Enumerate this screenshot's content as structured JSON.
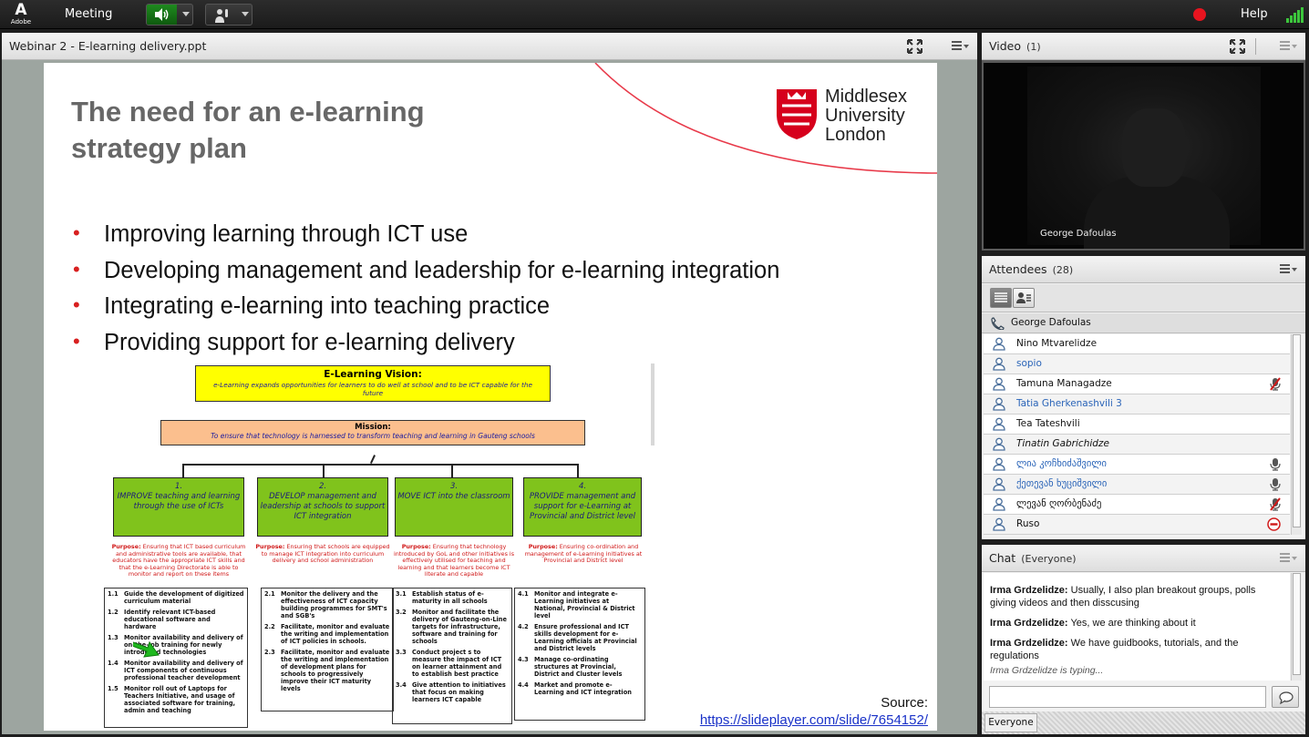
{
  "app": {
    "logo_text": "Adobe",
    "menu_meeting": "Meeting",
    "help": "Help"
  },
  "share": {
    "title": "Webinar 2 -  E-learning delivery.ppt",
    "slide": {
      "title_line1": "The need for an e-learning",
      "title_line2": "strategy plan",
      "logo": {
        "line1": "Middlesex",
        "line2": "University",
        "line3": "London"
      },
      "bullets": [
        "Improving learning through ICT use",
        "Developing management and leadership for e-learning integration",
        "Integrating e-learning into teaching practice",
        "Providing support for e-learning delivery"
      ],
      "source_label": "Source:",
      "source_url": "https://slideplayer.com/slide/7654152/",
      "diagram": {
        "vision_title": "E-Learning Vision:",
        "vision_text": "e-Learning expands opportunities for learners to do well at school and to be ICT capable for the future",
        "mission_title": "Mission:",
        "mission_text": "To ensure that technology is harnessed to transform teaching and learning in Gauteng schools",
        "goals": [
          {
            "num": "1.",
            "text": "IMPROVE teaching and learning through the use of ICTs"
          },
          {
            "num": "2.",
            "text": "DEVELOP management and leadership at schools to support ICT integration"
          },
          {
            "num": "3.",
            "text": "MOVE ICT into the classroom"
          },
          {
            "num": "4.",
            "text": "PROVIDE management and support for e-Learning at Provincial and District level"
          }
        ],
        "purpose_label": "Purpose:",
        "purposes": [
          "Ensuring that ICT based curriculum and administrative tools are available, that educators have the appropriate ICT skills and that the e-Learning Directorate is able to monitor and report on these items",
          "Ensuring that schools are equipped to manage ICT integration into curriculum delivery and school administration",
          "Ensuring that technology introduced by GoL and other initiatives is effectively utilised for teaching and learning and that learners become ICT literate and capable",
          "Ensuring co-ordination and management of e-Learning initiatives at Provincial and District level"
        ],
        "tasks": [
          [
            {
              "n": "1.1",
              "t": "Guide the development of digitized curriculum material"
            },
            {
              "n": "1.2",
              "t": "Identify relevant ICT-based educational software and hardware"
            },
            {
              "n": "1.3",
              "t": "Monitor availability and delivery of on-the-job training for newly introduced technologies"
            },
            {
              "n": "1.4",
              "t": "Monitor availability and delivery of ICT components of continuous professional teacher development"
            },
            {
              "n": "1.5",
              "t": "Monitor roll out of Laptops for Teachers Initiative, and usage of associated software for training, admin and teaching"
            }
          ],
          [
            {
              "n": "2.1",
              "t": "Monitor the delivery and the effectiveness of ICT capacity building programmes for SMT's and SGB's"
            },
            {
              "n": "2.2",
              "t": "Facilitate, monitor and evaluate the writing and implementation of ICT policies in schools."
            },
            {
              "n": "2.3",
              "t": "Facilitate, monitor and evaluate the writing and implementation of development plans for schools to progressively improve their ICT maturity levels"
            }
          ],
          [
            {
              "n": "3.1",
              "t": "Establish status of e-maturity in all schools"
            },
            {
              "n": "3.2",
              "t": "Monitor and facilitate the delivery of Gauteng-on-Line targets for infrastructure, software and training for schools"
            },
            {
              "n": "3.3",
              "t": "Conduct project s to measure the impact of ICT on learner attainment and to establish best practice"
            },
            {
              "n": "3.4",
              "t": "Give attention to initiatives that focus on making learners ICT capable"
            }
          ],
          [
            {
              "n": "4.1",
              "t": "Monitor and integrate e-Learning initiatives at National, Provincial & District level"
            },
            {
              "n": "4.2",
              "t": "Ensure professional and ICT skills development for e-Learning officials at Provincial and District levels"
            },
            {
              "n": "4.3",
              "t": "Manage co-ordinating structures at Provincial, District and Cluster levels"
            },
            {
              "n": "4.4",
              "t": "Market and promote e-Learning and ICT integration"
            }
          ]
        ]
      }
    }
  },
  "video": {
    "title": "Video",
    "count": "(1)",
    "presenter": "George Dafoulas"
  },
  "attendees": {
    "title": "Attendees",
    "count": "(28)",
    "host": "George Dafoulas",
    "list": [
      {
        "name": "Nino Mtvarelidze",
        "style": "normal",
        "status": ""
      },
      {
        "name": "sopio",
        "style": "blue",
        "status": ""
      },
      {
        "name": "Tamuna Managadze",
        "style": "normal",
        "status": "mic-muted"
      },
      {
        "name": "Tatia Gherkenashvili 3",
        "style": "blue",
        "status": ""
      },
      {
        "name": "Tea Tateshvili",
        "style": "normal",
        "status": ""
      },
      {
        "name": "Tinatin Gabrichidze",
        "style": "italic",
        "status": ""
      },
      {
        "name": "ლია კოჩხიძაშვილი",
        "style": "blue",
        "status": "mic"
      },
      {
        "name": "ქეთევან ხუციშვილი",
        "style": "blue",
        "status": "mic"
      },
      {
        "name": "ლევან ღორბენაძე",
        "style": "normal",
        "status": "mic-muted"
      },
      {
        "name": "Ruso",
        "style": "normal",
        "status": "no-entry"
      }
    ]
  },
  "chat": {
    "title": "Chat",
    "scope": "(Everyone)",
    "messages": [
      {
        "sender": "Irma Grdzelidze:",
        "text": "Usually, I also plan breakout groups, polls giving videos and then disscusing"
      },
      {
        "sender": "Irma Grdzelidze:",
        "text": "Yes, we are thinking about it"
      },
      {
        "sender": "Irma Grdzelidze:",
        "text": "We have guidbooks, tutorials, and the regulations"
      }
    ],
    "typing": "Irma Grdzelidze is typing...",
    "input_value": "",
    "recipient": "Everyone"
  },
  "colors": {
    "accent_green": "#2e9f2e",
    "record_red": "#e8141f",
    "link_blue": "#1a32c8",
    "attendee_blue": "#2a64b8",
    "mdx_red": "#d6001c"
  }
}
